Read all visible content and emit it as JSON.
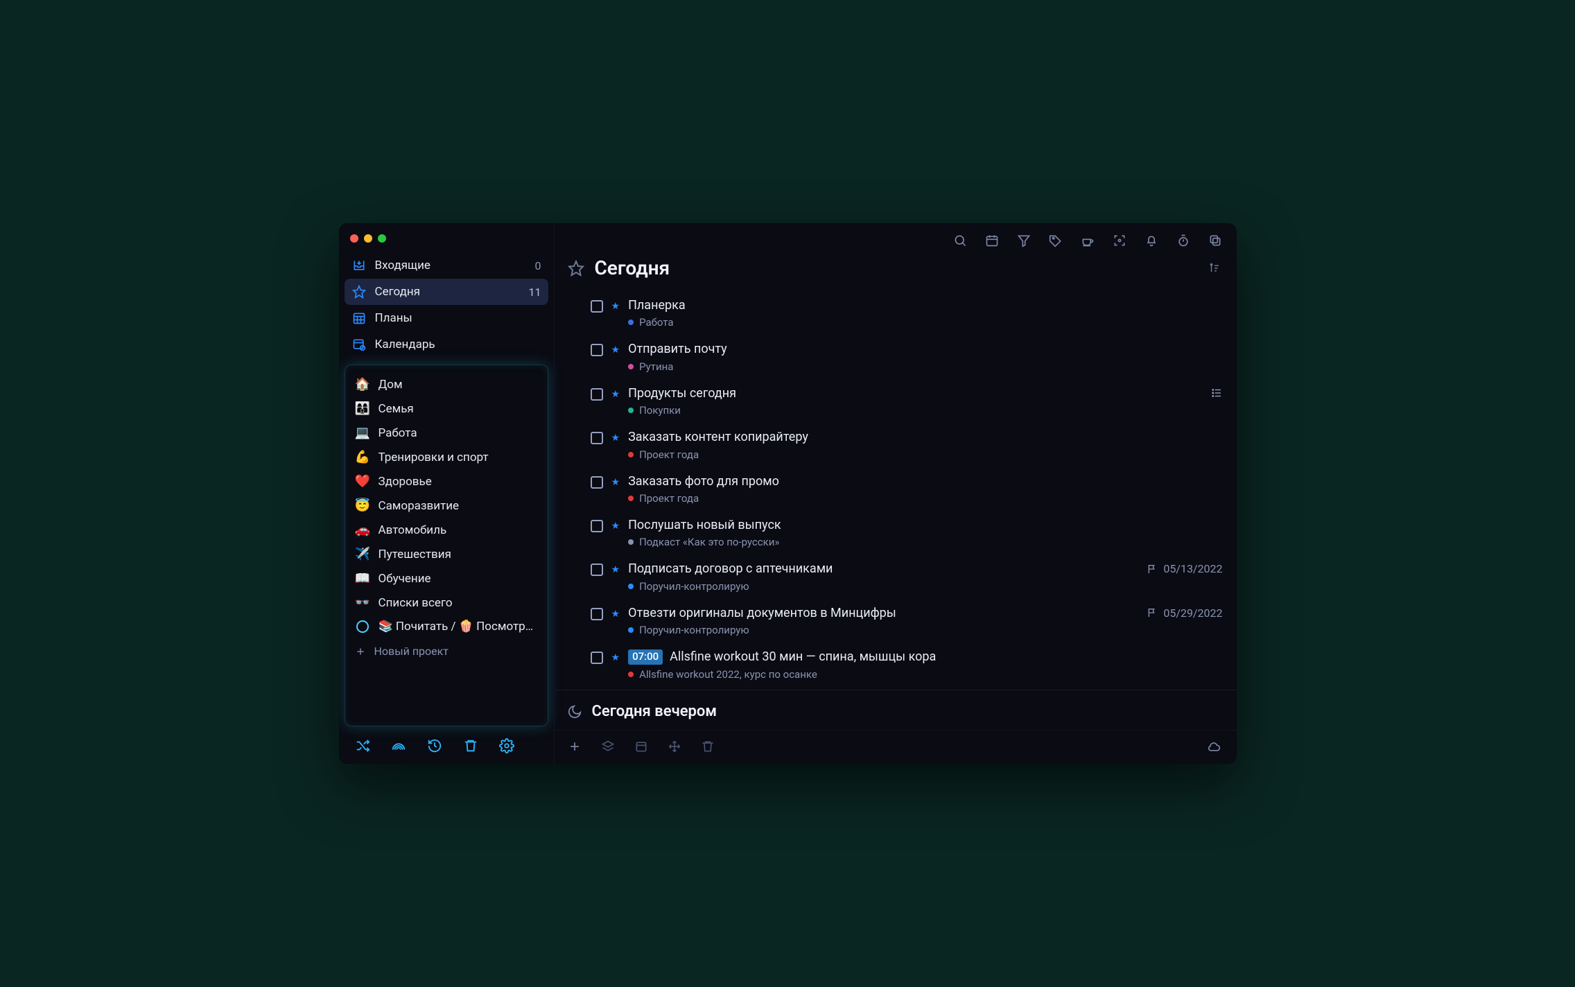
{
  "nav": {
    "inbox": {
      "label": "Входящие",
      "count": "0"
    },
    "today": {
      "label": "Сегодня",
      "count": "11"
    },
    "plans": {
      "label": "Планы"
    },
    "calendar": {
      "label": "Календарь"
    }
  },
  "projects": [
    {
      "emoji": "🏠",
      "label": "Дом"
    },
    {
      "emoji": "👩‍👩‍👦",
      "label": "Семья"
    },
    {
      "emoji": "💻",
      "label": "Работа"
    },
    {
      "emoji": "💪",
      "label": "Тренировки и спорт"
    },
    {
      "emoji": "❤️",
      "label": "Здоровье"
    },
    {
      "emoji": "😇",
      "label": "Саморазвитие"
    },
    {
      "emoji": "🚗",
      "label": "Автомобиль"
    },
    {
      "emoji": "✈️",
      "label": "Путешествия"
    },
    {
      "emoji": "📖",
      "label": "Обучение"
    },
    {
      "emoji": "👓",
      "label": "Списки всего"
    },
    {
      "emoji": "",
      "label": "📚 Почитать / 🍿 Посмотреть",
      "ring": true
    }
  ],
  "new_project": "Новый проект",
  "page_title": "Сегодня",
  "tasks": [
    {
      "title": "Планерка",
      "sub": "Работа",
      "color": "#3b6fe0"
    },
    {
      "title": "Отправить почту",
      "sub": "Рутина",
      "color": "#d24fa0"
    },
    {
      "title": "Продукты сегодня",
      "sub": "Покупки",
      "color": "#1fb497",
      "has_subtasks": true
    },
    {
      "title": "Заказать контент копирайтеру",
      "sub": "Проект года",
      "color": "#e03a3a"
    },
    {
      "title": "Заказать фото для промо",
      "sub": "Проект года",
      "color": "#e03a3a"
    },
    {
      "title": "Послушать новый выпуск",
      "sub": "Подкаст «Как это по-русски»",
      "color": "#8a93b0"
    },
    {
      "title": "Подписать договор с аптечниками",
      "sub": "Поручил-контролирую",
      "color": "#2a8cff",
      "flag_date": "05/13/2022"
    },
    {
      "title": "Отвезти оригиналы документов в Минцифры",
      "sub": "Поручил-контролирую",
      "color": "#2a8cff",
      "flag_date": "05/29/2022"
    },
    {
      "time": "07:00",
      "title": "Allsfine workout 30 мин — спина, мышцы кора",
      "sub": "Allsfine workout 2022, курс по осанке",
      "color": "#e03a3a"
    }
  ],
  "evening_title": "Сегодня вечером"
}
